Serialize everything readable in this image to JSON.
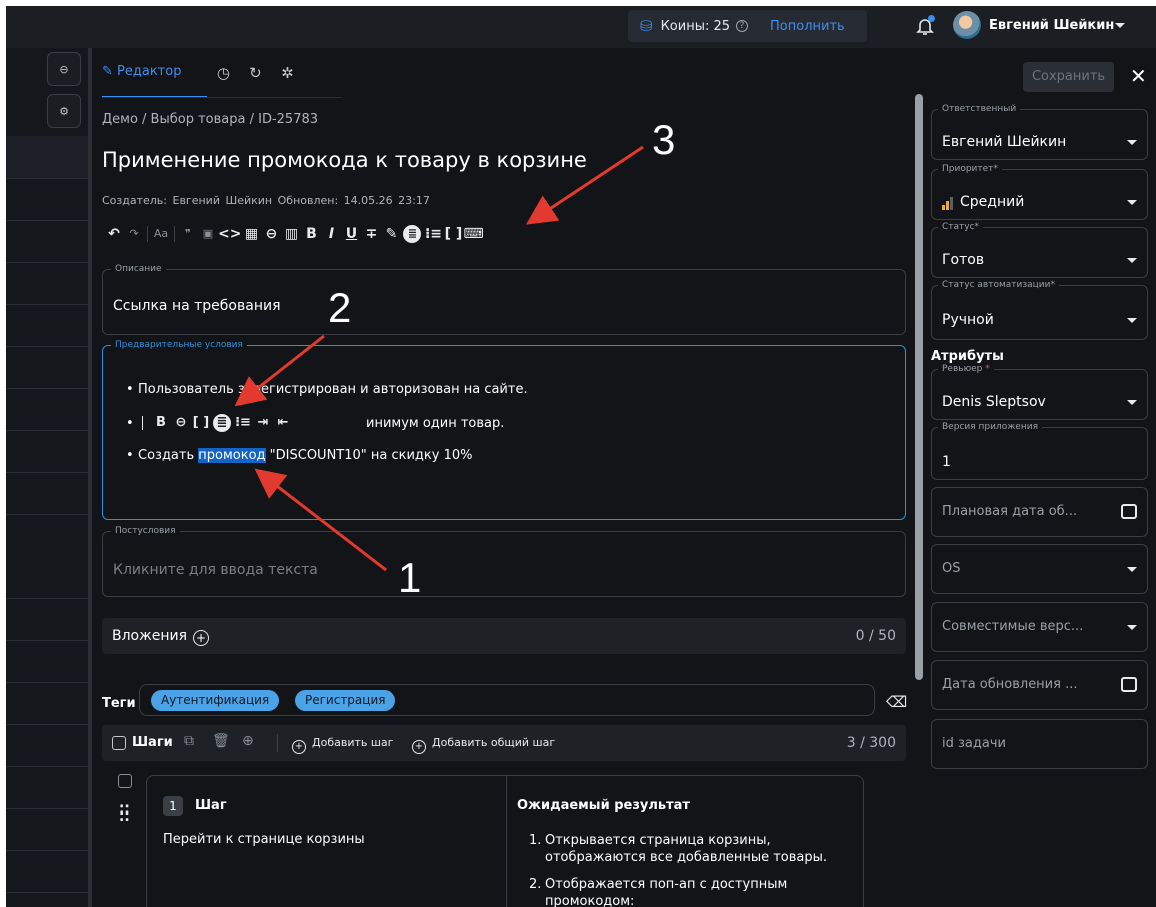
{
  "topbar": {
    "coins_label": "Коины: 25",
    "help_glyph": "?",
    "topup_label": "Пополнить",
    "user_name": "Евгений Шейкин",
    "icons": [
      "coins-icon",
      "help-icon",
      "bell-icon",
      "avatar",
      "chevron-down-icon"
    ]
  },
  "tabs": {
    "editor_label": "Редактор",
    "other_icons": [
      "history-icon",
      "refresh-icon",
      "bug-icon"
    ]
  },
  "header": {
    "breadcrumb": "Демо / Выбор товара / ID-25783",
    "title": "Применение промокода к товару в корзине",
    "meta": "Создатель: Евгений Шейкин  Обновлен: 14.05.26 23:17"
  },
  "toolbar": {
    "items": [
      "↶",
      "↷",
      "Aa",
      "❞",
      "▣",
      "<>",
      "▦",
      "⊖",
      "▥",
      "B",
      "I",
      "U",
      "∓",
      "✎",
      "≣",
      "⁝≡",
      "[ ]",
      "⌨"
    ],
    "item_names": [
      "undo-icon",
      "redo-icon",
      "font-size-icon",
      "quote-icon",
      "code-block-icon",
      "code-inline-icon",
      "table-icon",
      "link-icon",
      "image-icon",
      "bold-icon",
      "italic-icon",
      "underline-icon",
      "strikethrough-icon",
      "highlight-icon",
      "bullet-list-icon",
      "numbered-list-icon",
      "brackets-icon",
      "keyboard-icon"
    ]
  },
  "description": {
    "label": "Описание",
    "text": "Ссылка на требования"
  },
  "preconditions": {
    "label": "Предварительные условия",
    "items": [
      "Пользователь зарегистрирован и авторизован на сайте.",
      "инимум один товар.",
      [
        "Создать ",
        "промокод",
        " \"DISCOUNT10\" на скидку 10%"
      ]
    ],
    "inline_toolbar": [
      "B",
      "⊖",
      "[ ]",
      "≣",
      "⁝≡",
      "⇥",
      "⇤"
    ],
    "inline_toolbar_names": [
      "bold-icon",
      "link-icon",
      "brackets-icon",
      "bullet-list-icon",
      "numbered-list-icon",
      "indent-icon",
      "outdent-icon"
    ]
  },
  "postconditions": {
    "label": "Постусловия",
    "placeholder": "Кликните для ввода текста"
  },
  "attachments": {
    "label": "Вложения",
    "count": "0 / 50"
  },
  "tags": {
    "label": "Теги",
    "chips": [
      "Аутентификация",
      "Регистрация"
    ]
  },
  "steps": {
    "label": "Шаги",
    "add_step": "Добавить шаг",
    "add_shared_step": "Добавить общий шаг",
    "count": "3 / 300",
    "step": {
      "number": "1",
      "title": "Шаг",
      "action": "Перейти к странице корзины",
      "expected_title": "Ожидаемый результат",
      "expected": [
        {
          "n": "1.",
          "text": "Открывается страница корзины, отображаются все добавленные товары."
        },
        {
          "n": "2.",
          "text": "Отображается поп-ап с доступным промокодом:"
        }
      ]
    }
  },
  "right": {
    "save_label": "Сохранить",
    "close_glyph": "✕",
    "assignee_label": "Ответственный",
    "assignee": "Евгений Шейкин",
    "priority_label": "Приоритет*",
    "priority": "Средний",
    "status_label": "Статус*",
    "status": "Готов",
    "auto_label": "Статус автоматизации*",
    "auto": "Ручной",
    "attributes_title": "Атрибуты",
    "reviewer_label": "Ревьюер",
    "reviewer_req": "*",
    "reviewer": "Denis Sleptsov",
    "version_label": "Версия приложения",
    "version": "1",
    "planned_date": "Плановая дата об...",
    "os": "OS",
    "compat": "Совместимые верс...",
    "update_date": "Дата обновления ...",
    "task_id": "id задачи"
  },
  "annotations": {
    "numbers": [
      "1",
      "2",
      "3"
    ],
    "arrow_color": "#e23a2e"
  },
  "colors": {
    "accent": "#3d8ef0",
    "focus_border": "#2f8fd8",
    "chip": "#4aa3e6",
    "highlight": "#1464c8",
    "priority": "#f2a93b",
    "background": "#121417"
  }
}
